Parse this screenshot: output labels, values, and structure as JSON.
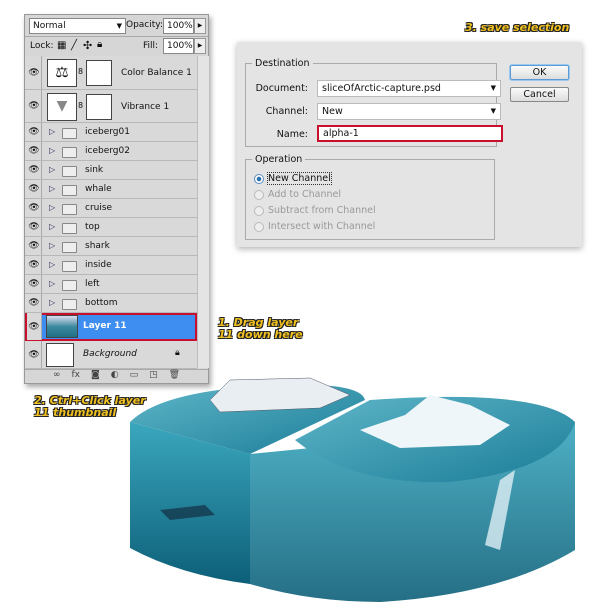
{
  "layers_panel": {
    "blend_mode": "Normal",
    "opacity_label": "Opacity:",
    "opacity": "100%",
    "lock_label": "Lock:",
    "fill_label": "Fill:",
    "fill": "100%",
    "adjustments": [
      {
        "name": "Color Balance 1",
        "icon": "scales-icon"
      },
      {
        "name": "Vibrance 1",
        "icon": "vibrance-triangle-icon"
      }
    ],
    "groups": [
      "iceberg01",
      "iceberg02",
      "sink",
      "whale",
      "cruise",
      "top",
      "shark",
      "inside",
      "left",
      "bottom"
    ],
    "selected_layer": "Layer 11",
    "selected_color": "#3d8ef0",
    "background_layer": "Background",
    "footer_icons": [
      "link-icon",
      "fx-icon",
      "mask-icon",
      "adjustment-icon",
      "folder-icon",
      "new-layer-icon",
      "trash-icon"
    ]
  },
  "dialog": {
    "destination_label": "Destination",
    "document_label": "Document:",
    "document": "sliceOfArctic-capture.psd",
    "channel_label": "Channel:",
    "channel": "New",
    "name_label": "Name:",
    "name": "alpha-1",
    "operation_label": "Operation",
    "operations": [
      "New Channel",
      "Add to Channel",
      "Subtract from Channel",
      "Intersect with Channel"
    ],
    "selected_operation": "New Channel",
    "ok": "OK",
    "cancel": "Cancel",
    "highlight_color": "#c8102e"
  },
  "annotations": {
    "step1": "1. Drag layer 11 down here",
    "step2": "2. Ctrl+Click layer 11 thumbnail",
    "step3": "3. save selection"
  }
}
